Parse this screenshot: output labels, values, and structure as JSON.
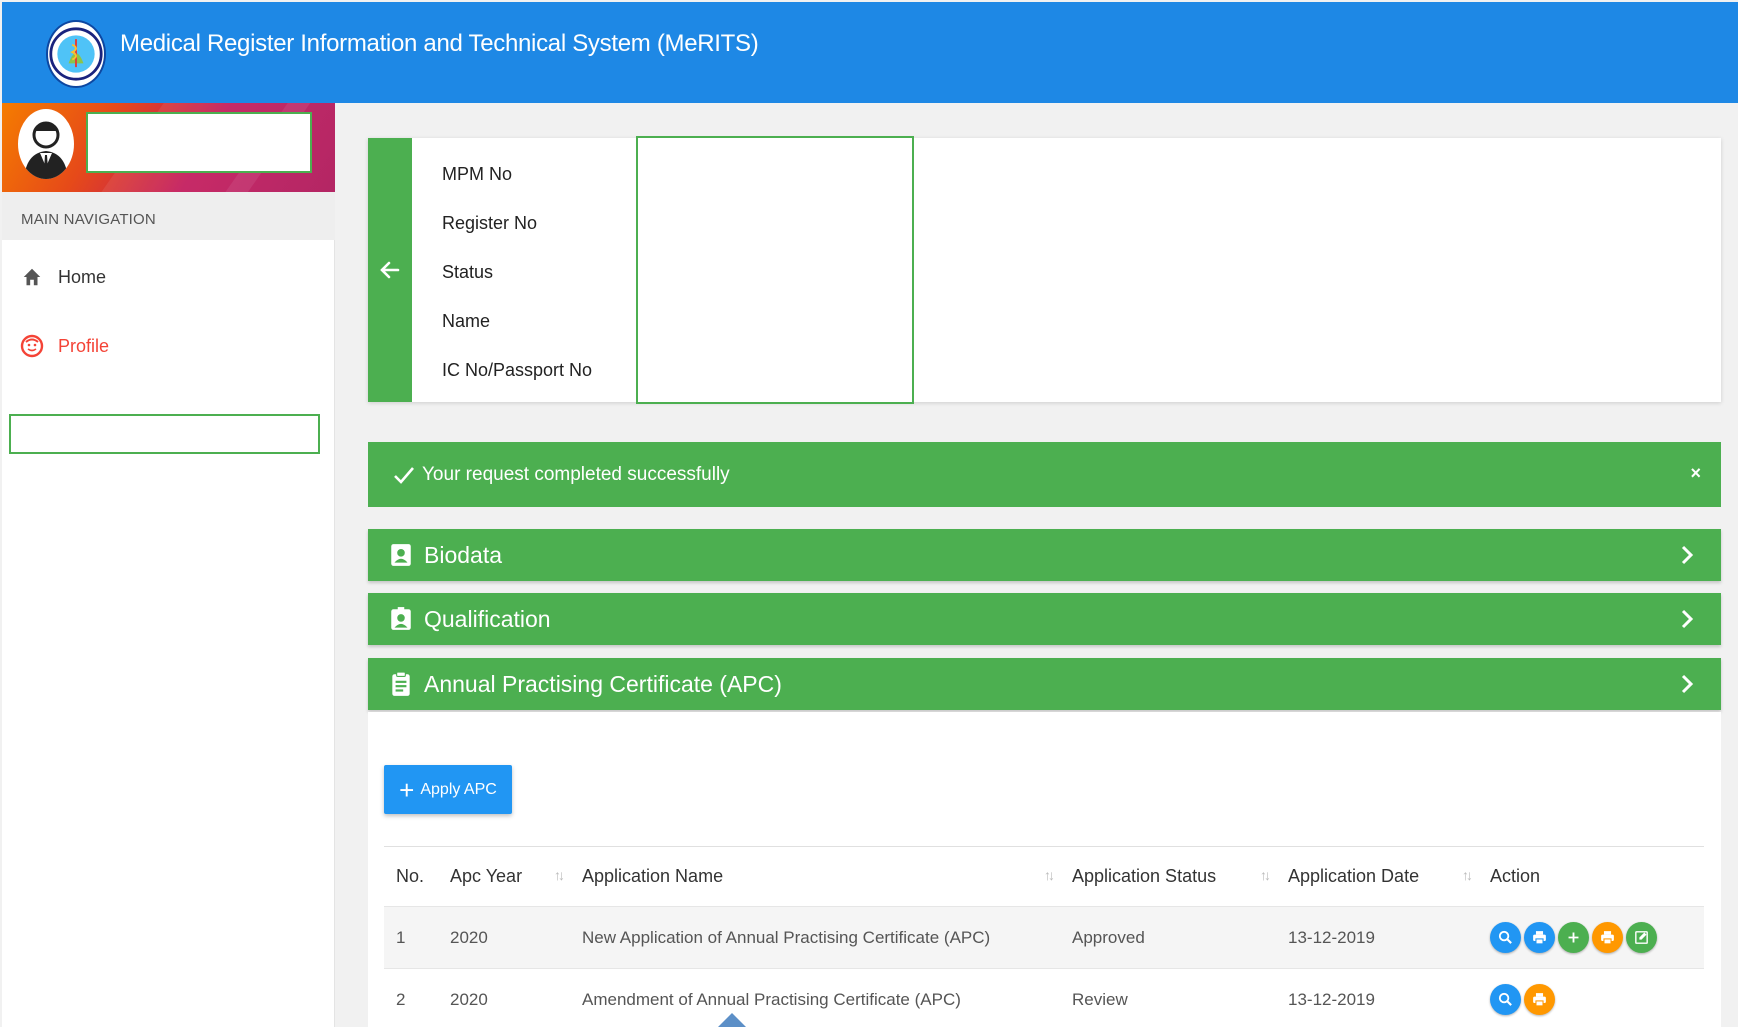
{
  "header": {
    "title": "Medical Register Information and Technical System (MeRITS)"
  },
  "sidebar": {
    "nav_header": "MAIN NAVIGATION",
    "items": [
      {
        "label": "Home"
      },
      {
        "label": "Profile"
      }
    ]
  },
  "profile": {
    "labels": [
      "MPM No",
      "Register No",
      "Status",
      "Name",
      "IC No/Passport No"
    ]
  },
  "alert": {
    "message": "Your request completed successfully",
    "close": "×"
  },
  "panels": [
    {
      "label": "Biodata"
    },
    {
      "label": "Qualification"
    },
    {
      "label": "Annual Practising Certificate (APC)"
    }
  ],
  "apc": {
    "apply_label": "Apply APC",
    "columns": [
      "No.",
      "Apc Year",
      "Application Name",
      "Application Status",
      "Application Date",
      "Action"
    ],
    "rows": [
      {
        "no": "1",
        "year": "2020",
        "name": "New Application of Annual Practising Certificate (APC)",
        "status": "Approved",
        "date": "13-12-2019"
      },
      {
        "no": "2",
        "year": "2020",
        "name": "Amendment of Annual Practising Certificate (APC)",
        "status": "Review",
        "date": "13-12-2019"
      }
    ]
  },
  "colors": {
    "header": "#1e88e5",
    "green": "#4caf50",
    "blue": "#2196f3",
    "orange": "#ff9800",
    "active": "#f44336"
  }
}
